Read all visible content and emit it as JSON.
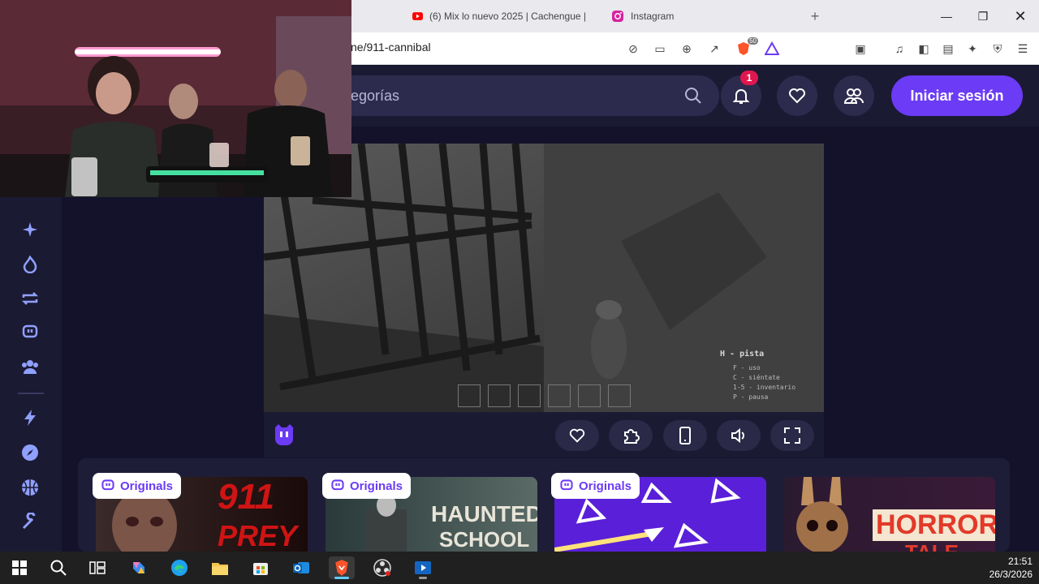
{
  "browser": {
    "tabs": [
      {
        "title": "(6) Mix lo nuevo 2025 | Cachengue |",
        "icon": "youtube-icon"
      },
      {
        "title": "Instagram",
        "icon": "instagram-icon"
      }
    ],
    "url": "ne/911-cannibal",
    "brave_badge": "50"
  },
  "header": {
    "search_placeholder": "egorías",
    "notification_count": "1",
    "login_label": "Iniciar sesión"
  },
  "sidebar": {
    "icons": [
      "star-sparkle-icon",
      "flame-icon",
      "refresh-icon",
      "twitch-icon",
      "group-icon",
      "bolt-icon",
      "compass-icon",
      "basketball-icon",
      "stick-icon"
    ]
  },
  "game": {
    "hint_title": "H - pista",
    "hint_lines": [
      "F - uso",
      "C - siéntate",
      "1-5 - inventario",
      "P - pausa"
    ]
  },
  "cards": [
    {
      "badge": "Originals",
      "title_line1": "911",
      "title_line2": "PREY"
    },
    {
      "badge": "Originals",
      "title_line1": "HAUNTED",
      "title_line2": "SCHOOL"
    },
    {
      "badge": "Originals",
      "title_line1": "",
      "title_line2": ""
    },
    {
      "badge": "",
      "title_line1": "HORROR",
      "title_line2": "TALE"
    }
  ],
  "taskbar": {
    "time": "21:51",
    "date": "26/3/2026"
  },
  "colors": {
    "accent": "#6b3bf5",
    "background": "#14122b",
    "panel": "#1b1a33"
  }
}
